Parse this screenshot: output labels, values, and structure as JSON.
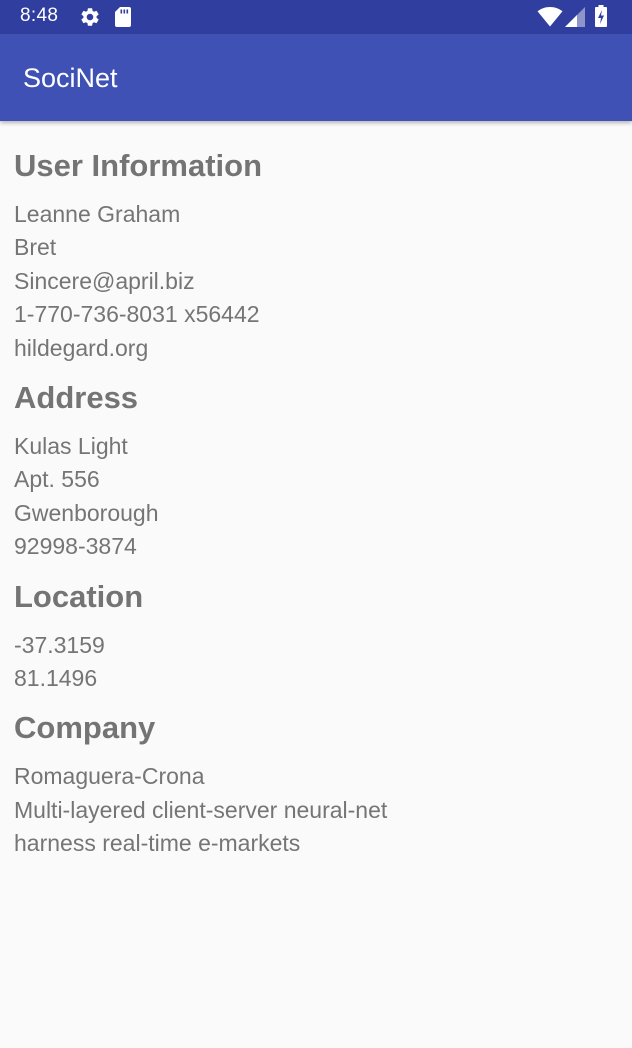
{
  "status_bar": {
    "time": "8:48",
    "icons": [
      "gear-icon",
      "sd-card-icon",
      "wifi-icon",
      "cell-signal-icon",
      "battery-charging-icon"
    ]
  },
  "app_bar": {
    "title": "SociNet"
  },
  "colors": {
    "status_bar": "#303f9f",
    "app_bar": "#3f51b5",
    "background": "#fafafa",
    "text": "#757575"
  },
  "sections": {
    "user_info": {
      "title": "User Information",
      "lines": [
        "Leanne Graham",
        "Bret",
        "Sincere@april.biz",
        "1-770-736-8031 x56442",
        "hildegard.org"
      ]
    },
    "address": {
      "title": "Address",
      "lines": [
        "Kulas Light",
        "Apt. 556",
        "Gwenborough",
        "92998-3874"
      ]
    },
    "location": {
      "title": "Location",
      "lines": [
        "-37.3159",
        "81.1496"
      ]
    },
    "company": {
      "title": "Company",
      "lines": [
        "Romaguera-Crona",
        "Multi-layered client-server neural-net",
        "harness real-time e-markets"
      ]
    }
  }
}
